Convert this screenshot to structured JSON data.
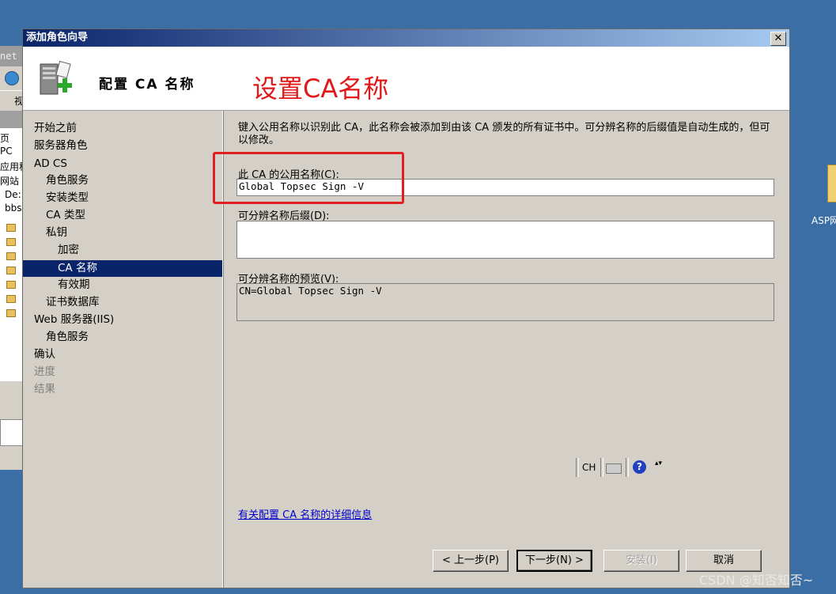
{
  "background_window": {
    "menu_fragment": "net",
    "view_fragment": "视",
    "items": [
      "页",
      "PC",
      "应用程",
      "网站",
      "De:",
      "bbs"
    ]
  },
  "desktop": {
    "folder_label": "ASP网"
  },
  "dialog": {
    "title": "添加角色向导",
    "close_symbol": "✕",
    "header_title": "配置 CA 名称",
    "annotation_title": "设置CA名称"
  },
  "nav": {
    "items": [
      {
        "label": "开始之前",
        "level": 0,
        "state": "normal"
      },
      {
        "label": "服务器角色",
        "level": 0,
        "state": "normal"
      },
      {
        "label": "AD CS",
        "level": 0,
        "state": "normal"
      },
      {
        "label": "角色服务",
        "level": 1,
        "state": "normal"
      },
      {
        "label": "安装类型",
        "level": 1,
        "state": "normal"
      },
      {
        "label": "CA 类型",
        "level": 1,
        "state": "normal"
      },
      {
        "label": "私钥",
        "level": 1,
        "state": "normal"
      },
      {
        "label": "加密",
        "level": 2,
        "state": "normal"
      },
      {
        "label": "CA 名称",
        "level": 2,
        "state": "selected"
      },
      {
        "label": "有效期",
        "level": 2,
        "state": "normal"
      },
      {
        "label": "证书数据库",
        "level": 1,
        "state": "normal"
      },
      {
        "label": "Web 服务器(IIS)",
        "level": 0,
        "state": "normal"
      },
      {
        "label": "角色服务",
        "level": 1,
        "state": "normal"
      },
      {
        "label": "确认",
        "level": 0,
        "state": "normal"
      },
      {
        "label": "进度",
        "level": 0,
        "state": "disabled"
      },
      {
        "label": "结果",
        "level": 0,
        "state": "disabled"
      }
    ]
  },
  "content": {
    "description": "键入公用名称以识别此 CA，此名称会被添加到由该 CA 颁发的所有证书中。可分辨名称的后缀值是自动生成的，但可以修改。",
    "common_name_label": "此 CA 的公用名称(C):",
    "common_name_value": "Global Topsec Sign -V",
    "suffix_label": "可分辨名称后缀(D):",
    "suffix_value": "",
    "preview_label": "可分辨名称的预览(V):",
    "preview_value": "CN=Global Topsec Sign -V",
    "more_info_link": "有关配置 CA 名称的详细信息"
  },
  "language_bar": {
    "lang": "CH",
    "help": "?",
    "options": "▴▾"
  },
  "buttons": {
    "back": "< 上一步(P)",
    "next": "下一步(N) >",
    "install": "安装(I)",
    "cancel": "取消"
  },
  "watermark": "CSDN @知否知否~",
  "colors": {
    "desktop": "#3a6ea5",
    "title_gradient_start": "#0a246a",
    "title_gradient_end": "#a6caf0",
    "selection": "#0a246a",
    "annotation_red": "#e01818",
    "link": "#0000cc"
  }
}
